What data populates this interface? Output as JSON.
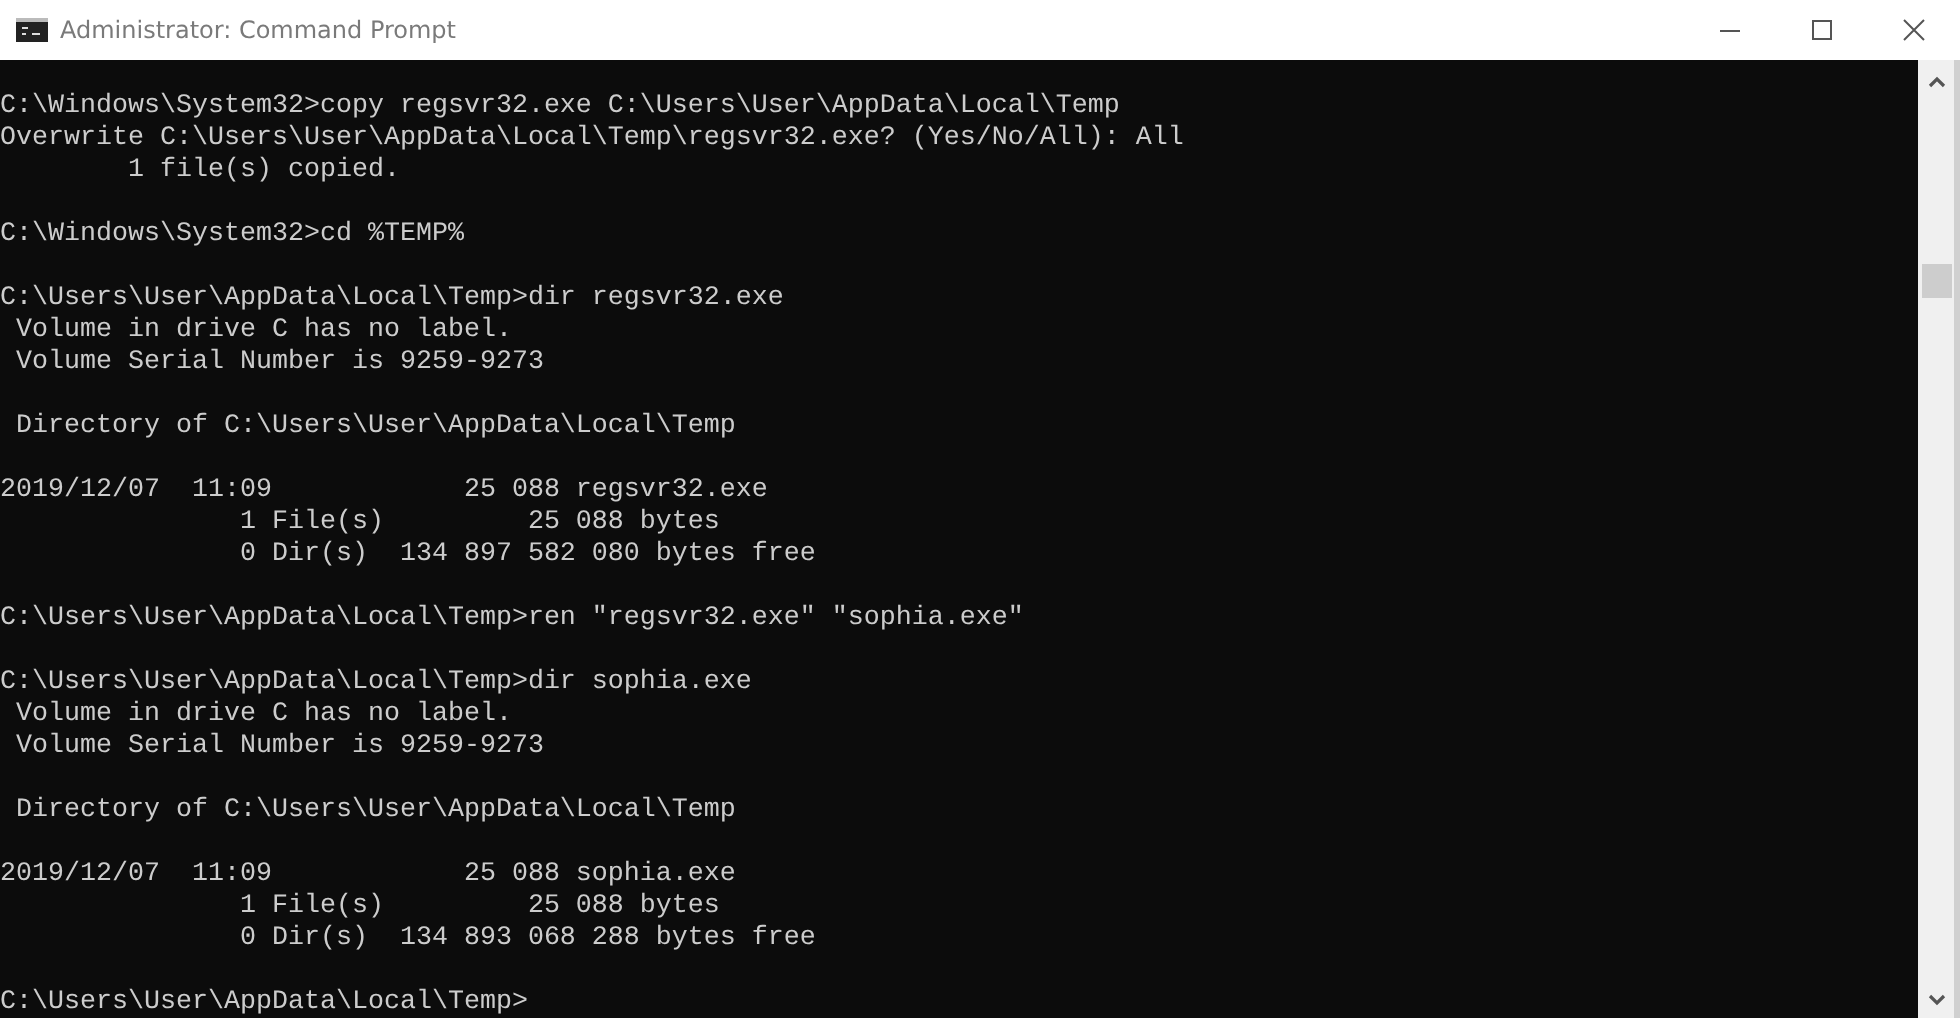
{
  "window": {
    "title": "Administrator: Command Prompt"
  },
  "console": {
    "blocks": [
      [
        "C:\\Windows\\System32>copy regsvr32.exe C:\\Users\\User\\AppData\\Local\\Temp",
        "Overwrite C:\\Users\\User\\AppData\\Local\\Temp\\regsvr32.exe? (Yes/No/All): All",
        "        1 file(s) copied."
      ],
      [
        "C:\\Windows\\System32>cd %TEMP%"
      ],
      [
        "C:\\Users\\User\\AppData\\Local\\Temp>dir regsvr32.exe",
        " Volume in drive C has no label.",
        " Volume Serial Number is 9259-9273"
      ],
      [
        " Directory of C:\\Users\\User\\AppData\\Local\\Temp"
      ],
      [
        "2019/12/07  11:09            25 088 regsvr32.exe",
        "               1 File(s)         25 088 bytes",
        "               0 Dir(s)  134 897 582 080 bytes free"
      ],
      [
        "C:\\Users\\User\\AppData\\Local\\Temp>ren \"regsvr32.exe\" \"sophia.exe\""
      ],
      [
        "C:\\Users\\User\\AppData\\Local\\Temp>dir sophia.exe",
        " Volume in drive C has no label.",
        " Volume Serial Number is 9259-9273"
      ],
      [
        " Directory of C:\\Users\\User\\AppData\\Local\\Temp"
      ],
      [
        "2019/12/07  11:09            25 088 sophia.exe",
        "               1 File(s)         25 088 bytes",
        "               0 Dir(s)  134 893 068 288 bytes free"
      ],
      [
        "C:\\Users\\User\\AppData\\Local\\Temp>"
      ]
    ]
  }
}
